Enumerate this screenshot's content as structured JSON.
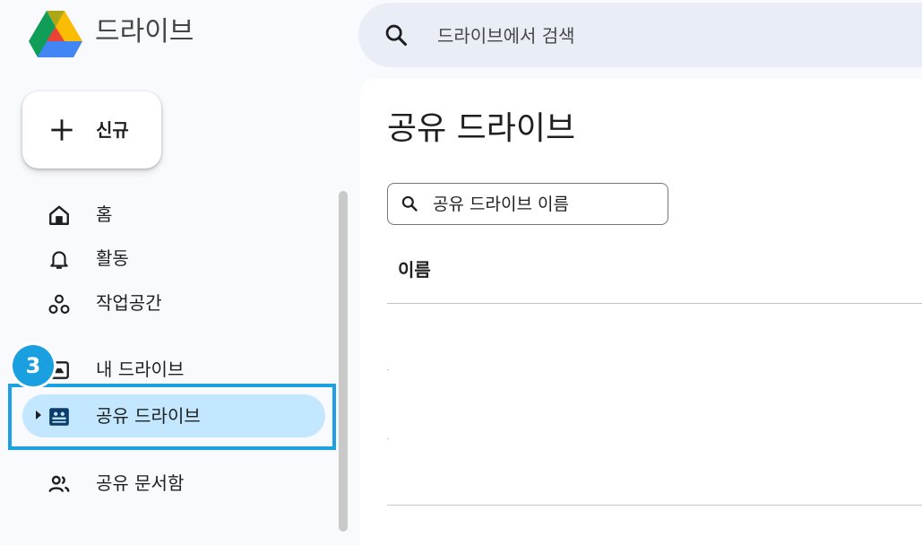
{
  "app": {
    "name": "드라이브"
  },
  "search": {
    "placeholder": "드라이브에서 검색"
  },
  "new_button": {
    "label": "신규"
  },
  "sidebar": {
    "items": [
      {
        "id": "home",
        "label": "홈",
        "icon": "home-icon"
      },
      {
        "id": "activity",
        "label": "활동",
        "icon": "bell-icon"
      },
      {
        "id": "workspaces",
        "label": "작업공간",
        "icon": "workspaces-icon"
      },
      {
        "id": "my-drive",
        "label": "내 드라이브",
        "icon": "my-drive-icon"
      },
      {
        "id": "shared-drives",
        "label": "공유 드라이브",
        "icon": "shared-drives-icon",
        "active": true
      },
      {
        "id": "shared-with-me",
        "label": "공유 문서함",
        "icon": "people-icon"
      }
    ]
  },
  "annotation": {
    "step": "3"
  },
  "main": {
    "title": "공유 드라이브",
    "search_placeholder": "공유 드라이브 이름",
    "column_header": "이름"
  },
  "colors": {
    "background": "#f8fafd",
    "active_item": "#c2e7ff",
    "highlight": "#1ca1e3",
    "search_bg": "#e9eef6"
  }
}
